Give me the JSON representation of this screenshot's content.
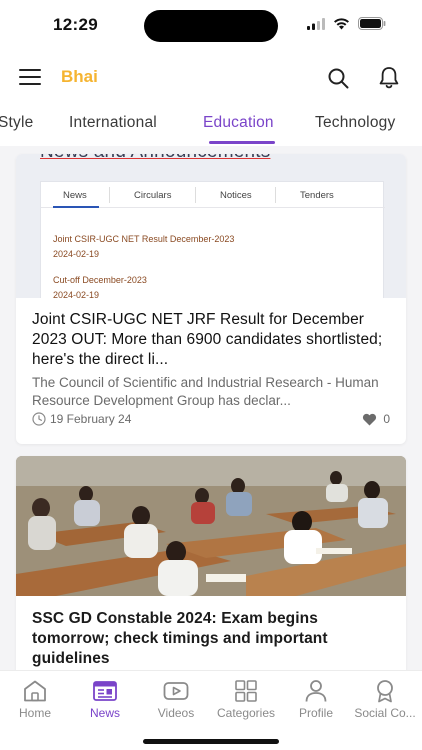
{
  "status": {
    "time": "12:29"
  },
  "header": {
    "brand": "Bhai"
  },
  "categories": [
    {
      "label": "Style"
    },
    {
      "label": "International"
    },
    {
      "label": "Education",
      "active": true
    },
    {
      "label": "Technology"
    }
  ],
  "articles": [
    {
      "image": {
        "heading": "News and Announcements",
        "tabs": [
          "News",
          "Circulars",
          "Notices",
          "Tenders"
        ],
        "items": [
          {
            "title": "Joint CSIR-UGC NET Result December-2023",
            "date": "2024-02-19"
          },
          {
            "title": "Cut-off December-2023",
            "date": "2024-02-19"
          }
        ]
      },
      "title": "Joint CSIR-UGC NET JRF Result for December 2023 OUT: More than 6900 candidates shortlisted; here's the direct li...",
      "snippet": "The Council of Scientific and Industrial Research - Human Resource Development Group has declar...",
      "date": "19 February 24",
      "likes": "0"
    },
    {
      "title": "SSC GD Constable 2024: Exam begins tomorrow; check timings and important guidelines"
    }
  ],
  "nav": {
    "items": [
      {
        "label": "Home",
        "icon": "home-icon"
      },
      {
        "label": "News",
        "icon": "news-icon",
        "active": true
      },
      {
        "label": "Videos",
        "icon": "video-icon"
      },
      {
        "label": "Categories",
        "icon": "categories-icon"
      },
      {
        "label": "Profile",
        "icon": "profile-icon"
      },
      {
        "label": "Social Co...",
        "icon": "social-icon"
      }
    ]
  },
  "colors": {
    "accent": "#7a44c9",
    "brand": "#f5b431"
  }
}
